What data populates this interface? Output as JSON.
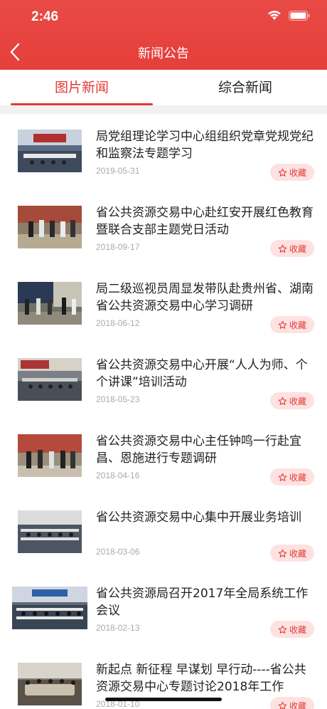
{
  "status_bar": {
    "time": "2:46"
  },
  "header": {
    "title": "新闻公告"
  },
  "tabs": [
    {
      "label": "图片新闻",
      "active": true
    },
    {
      "label": "综合新闻",
      "active": false
    }
  ],
  "colors": {
    "primary": "#e23a36",
    "fav_bg": "#fde2e1"
  },
  "fav_label": "收藏",
  "news": [
    {
      "title": "局党组理论学习中心组组织党章党规党纪和监察法专题学习",
      "date": "2019-05-31"
    },
    {
      "title": "省公共资源交易中心赴红安开展红色教育暨联合支部主题党日活动",
      "date": "2018-09-17"
    },
    {
      "title": "局二级巡视员周显发带队赴贵州省、湖南省公共资源交易中心学习调研",
      "date": "2018-06-12"
    },
    {
      "title": "省公共资源交易中心开展“人人为师、个个讲课”培训活动",
      "date": "2018-05-23"
    },
    {
      "title": "省公共资源交易中心主任钟鸣一行赴宜昌、恩施进行专题调研",
      "date": "2018-04-16"
    },
    {
      "title": "省公共资源交易中心集中开展业务培训",
      "date": "2018-03-06"
    },
    {
      "title": "省公共资源局召开2017年全局系统工作会议",
      "date": "2018-02-13"
    },
    {
      "title": "新起点 新征程 早谋划 早行动----省公共资源交易中心专题讨论2018年工作",
      "date": "2018-01-10"
    }
  ]
}
